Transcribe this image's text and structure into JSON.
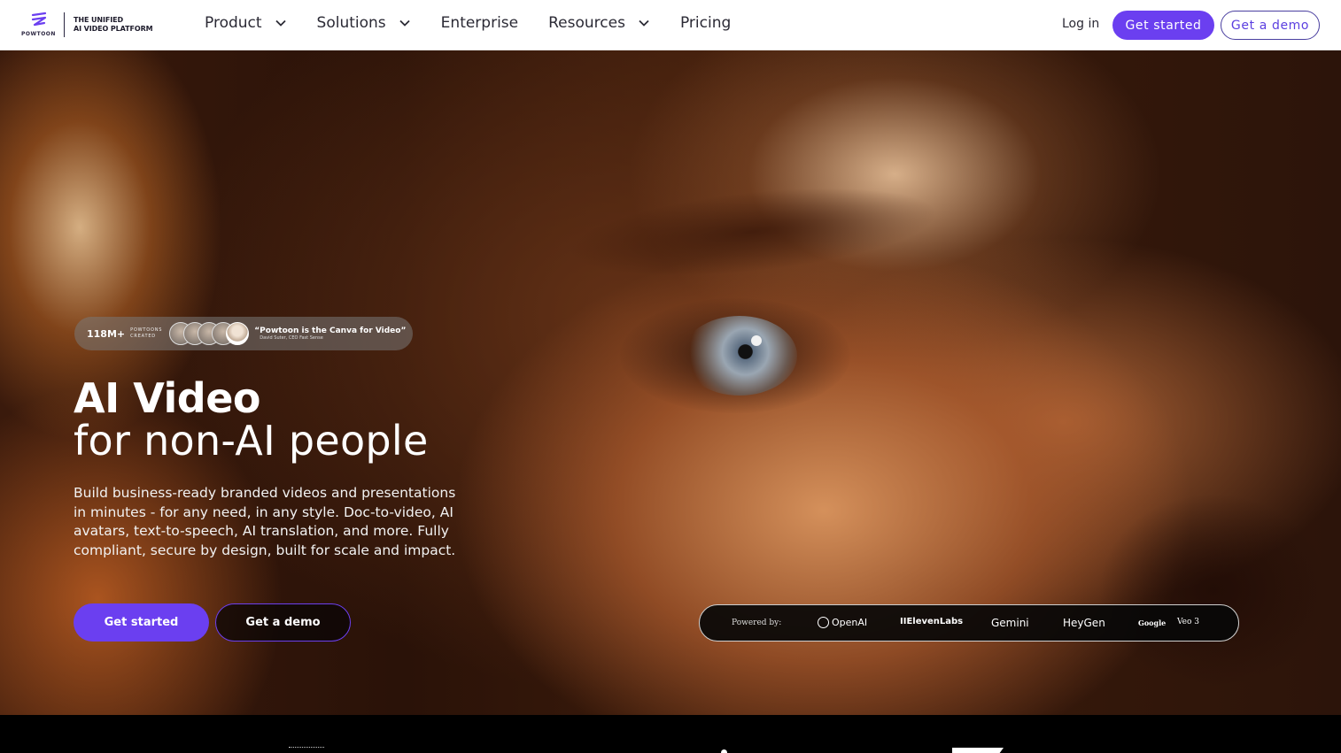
{
  "brand": {
    "wordmark": "POWTOON",
    "tagline_line1": "THE UNIFIED",
    "tagline_line2": "AI VIDEO PLATFORM",
    "accent": "#6b3ff0"
  },
  "nav": {
    "items": [
      {
        "label": "Product",
        "dropdown": true
      },
      {
        "label": "Solutions",
        "dropdown": true
      },
      {
        "label": "Enterprise",
        "dropdown": false
      },
      {
        "label": "Resources",
        "dropdown": true
      },
      {
        "label": "Pricing",
        "dropdown": false
      }
    ],
    "login_label": "Log in",
    "get_started_label": "Get started",
    "get_demo_label": "Get a demo"
  },
  "hero": {
    "proof": {
      "count": "118M+",
      "label_line1": "POWTOONS",
      "label_line2": "CREATED",
      "quote": "“Powtoon is the Canva for Video”",
      "author": "David Suter, CEO Fast Sense"
    },
    "title_bold": "AI Video",
    "title_light": "for non-AI people",
    "description": "Build business-ready branded videos and presentations in minutes - for any need, in any style. Doc-to-video, AI avatars, text-to-speech, AI translation, and more. Fully compliant, secure by design, built for scale and impact.",
    "cta_primary": "Get started",
    "cta_secondary": "Get a demo"
  },
  "powered_by": {
    "label": "Powered by:",
    "partners": [
      "OpenAI",
      "IIElevenLabs",
      "Gemini",
      "HeyGen",
      "Google",
      "Veo 3"
    ]
  },
  "icons": {
    "logo": "powtoon-logo-icon",
    "dropdown": "chevron-down-icon",
    "openai": "openai-logo-icon"
  }
}
